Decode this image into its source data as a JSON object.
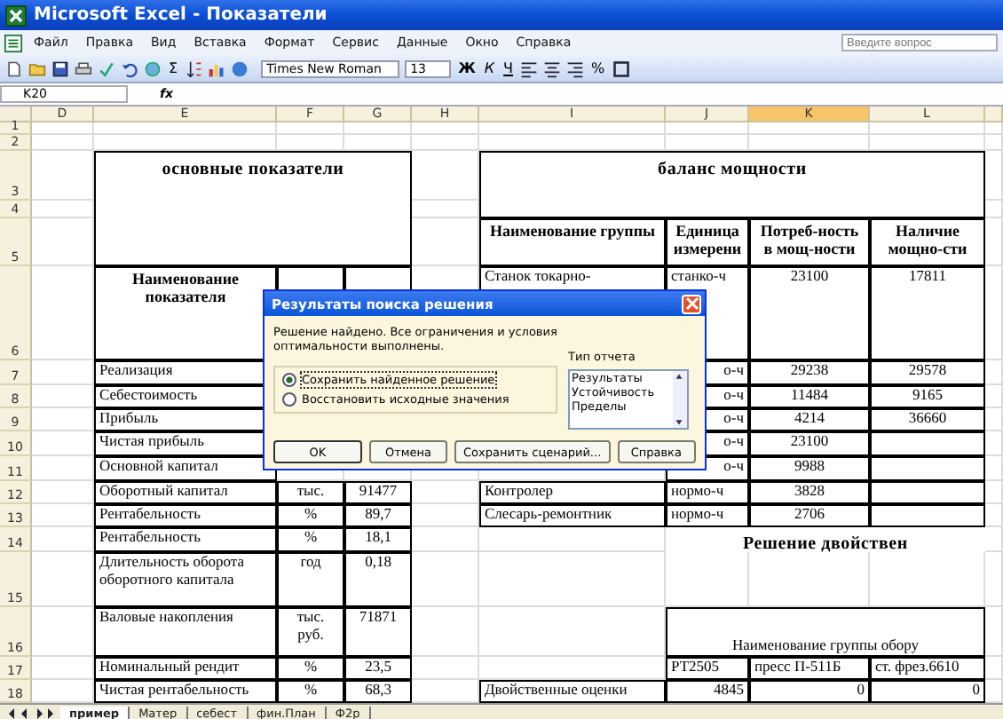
{
  "window": {
    "title": "Microsoft Excel - Показатели"
  },
  "menu": [
    {
      "label": "Файл"
    },
    {
      "label": "Правка"
    },
    {
      "label": "Вид"
    },
    {
      "label": "Вставка"
    },
    {
      "label": "Формат"
    },
    {
      "label": "Сервис"
    },
    {
      "label": "Данные"
    },
    {
      "label": "Окно"
    },
    {
      "label": "Справка"
    }
  ],
  "help_search": {
    "placeholder": "Введите вопрос"
  },
  "toolbar": {
    "sigma": "Σ",
    "font": "Times New Roman",
    "size": "13",
    "bold": "Ж",
    "italic": "К",
    "underline": "Ч",
    "percent": "%"
  },
  "formula_bar": {
    "name_box": "K20",
    "fx": "fx"
  },
  "columns": [
    {
      "label": "D",
      "selected": false
    },
    {
      "label": "E",
      "selected": false
    },
    {
      "label": "F",
      "selected": false
    },
    {
      "label": "G",
      "selected": false
    },
    {
      "label": "H",
      "selected": false
    },
    {
      "label": "I",
      "selected": false
    },
    {
      "label": "J",
      "selected": false
    },
    {
      "label": "K",
      "selected": true
    },
    {
      "label": "L",
      "selected": false
    }
  ],
  "row_numbers": [
    "1",
    "2",
    "3",
    "4",
    "5",
    "6",
    "7",
    "8",
    "9",
    "10",
    "11",
    "12",
    "13",
    "14",
    "15",
    "16",
    "17",
    "18"
  ],
  "left_table": {
    "title": "основные показатели",
    "heading": "Наименование показателя",
    "rows": [
      {
        "name": "Реализация"
      },
      {
        "name": "Себестоимость"
      },
      {
        "name": "Прибыль"
      },
      {
        "name": "Чистая прибыль"
      },
      {
        "name": "Основной капитал"
      },
      {
        "name": "Оборотный капитал",
        "unit": "тыс.",
        "value": "91477"
      },
      {
        "name": "Рентабельность",
        "unit": "%",
        "value": "89,7"
      },
      {
        "name": "Рентабельность",
        "unit": "%",
        "value": "18,1"
      },
      {
        "name": "Длительность оборота оборотного капитала",
        "unit": "год",
        "value": "0,18"
      },
      {
        "name": "Валовые накопления",
        "unit": "тыс. руб.",
        "value": "71871"
      },
      {
        "name": "Номинальный рендит",
        "unit": "%",
        "value": "23,5"
      },
      {
        "name": "Чистая рентабельность",
        "unit": "%",
        "value": "68,3"
      }
    ]
  },
  "right_table": {
    "title": "баланс мощности",
    "columns": [
      "Наименование группы",
      "Единица измерени",
      "Потреб-ность в мощ-ности",
      "Наличие мощно-сти"
    ],
    "rows": [
      {
        "name": "Станок токарно-",
        "unit": "станко-ч",
        "need": "23100",
        "available": "17811"
      },
      {
        "unit": "о-ч",
        "need": "29238",
        "available": "29578"
      },
      {
        "unit": "о-ч",
        "need": "11484",
        "available": "9165"
      },
      {
        "unit": "о-ч",
        "need": "4214",
        "available": "36660"
      },
      {
        "unit": "о-ч",
        "need": "23100"
      },
      {
        "unit": "о-ч",
        "need": "9988"
      },
      {
        "name": "Контролер",
        "unit": "нормо-ч",
        "need": "3828"
      },
      {
        "name": "Слесарь-ремонтник",
        "unit": "нормо-ч",
        "need": "2706"
      }
    ]
  },
  "dual": {
    "title": "Решение двойствен",
    "group_heading": "Наименование группы обору",
    "equipment": [
      "РТ2505",
      "пресс П-511Б",
      "ст. фрез.6610"
    ],
    "row_label": "Двойственные оценки",
    "values": [
      "4845",
      "0",
      "0"
    ]
  },
  "sheet_tabs": [
    {
      "label": "пример",
      "selected": true
    },
    {
      "label": "Матер",
      "selected": false
    },
    {
      "label": "себест",
      "selected": false
    },
    {
      "label": "фин.План",
      "selected": false
    },
    {
      "label": "Ф2р",
      "selected": false
    }
  ],
  "dialog": {
    "title": "Результаты поиска решения",
    "message": "Решение найдено. Все ограничения и условия оптимальности выполнены.",
    "options": [
      {
        "label": "Сохранить найденное решение",
        "selected": true
      },
      {
        "label": "Восстановить исходные значения",
        "selected": false
      }
    ],
    "report_label": "Тип отчета",
    "reports": [
      "Результаты",
      "Устойчивость",
      "Пределы"
    ],
    "buttons": [
      "OK",
      "Отмена",
      "Сохранить сценарий...",
      "Справка"
    ]
  }
}
